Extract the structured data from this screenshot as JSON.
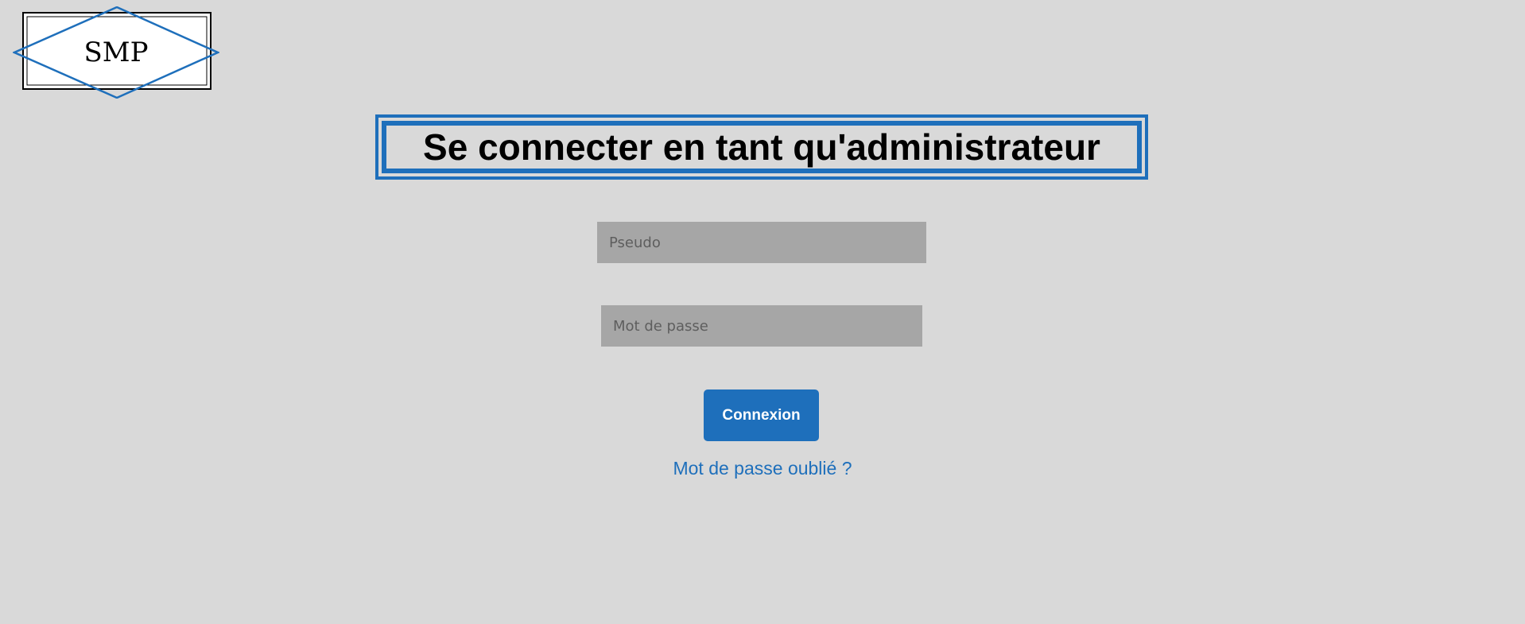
{
  "logo": {
    "text": "SMP"
  },
  "page_title": "Se connecter en tant qu'administrateur",
  "form": {
    "pseudo_placeholder": "Pseudo",
    "pseudo_value": "",
    "password_placeholder": "Mot de passe",
    "password_value": "",
    "submit_label": "Connexion",
    "forgot_label": "Mot de passe oublié ?"
  },
  "colors": {
    "background": "#d9d9d9",
    "accent": "#1e6fbb",
    "input_fill": "#a6a6a6"
  }
}
